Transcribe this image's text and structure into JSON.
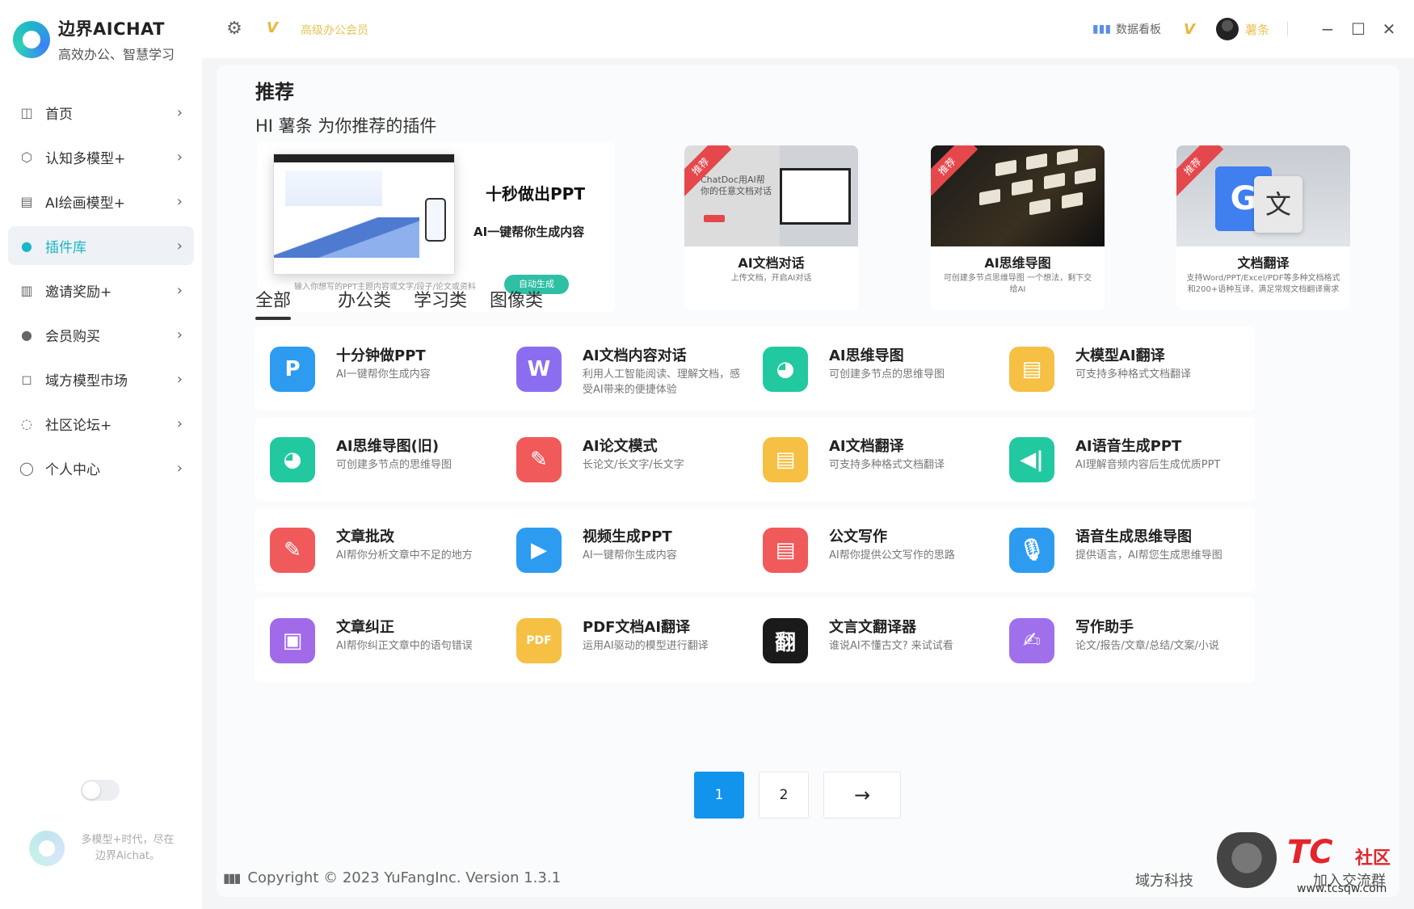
{
  "brand": {
    "title": "边界AICHAT",
    "subtitle": "高效办公、智慧学习"
  },
  "sidebar": {
    "items": [
      {
        "label": "首页",
        "icon": "home-icon",
        "glyph": "◫"
      },
      {
        "label": "认知多模型+",
        "icon": "cube-icon",
        "glyph": "⬡"
      },
      {
        "label": "AI绘画模型+",
        "icon": "image-icon",
        "glyph": "▤"
      },
      {
        "label": "插件库",
        "icon": "lightbulb-icon",
        "glyph": "●"
      },
      {
        "label": "邀请奖励+",
        "icon": "gift-icon",
        "glyph": "▥"
      },
      {
        "label": "会员购买",
        "icon": "user-icon",
        "glyph": "●"
      },
      {
        "label": "域方模型市场",
        "icon": "shop-icon",
        "glyph": "◻"
      },
      {
        "label": "社区论坛+",
        "icon": "chat-icon",
        "glyph": "◌"
      },
      {
        "label": "个人中心",
        "icon": "person-icon",
        "glyph": "◯"
      }
    ],
    "active_index": 3,
    "footer_text": "多模型+时代，尽在边界Aichat。"
  },
  "topbar": {
    "vip_label": "高级办公会员",
    "dashboard_label": "数据看板",
    "user_name": "薯条"
  },
  "main": {
    "section_title": "推荐",
    "greeting": "HI 薯条 为你推荐的插件",
    "banner": {
      "title": "十秒做出PPT",
      "subtitle": "AI一键帮你生成内容",
      "description": "输入你想写的PPT主题内容或文字/段子/论文或资料",
      "button": "自动生成"
    },
    "recommended": [
      {
        "ribbon": "推荐",
        "title": "AI文档对话",
        "desc": "上传文档，开启AI对话",
        "image_text": "ChatDoc用AI帮你的任意文档对话"
      },
      {
        "ribbon": "推荐",
        "title": "AI思维导图",
        "desc": "可创建多节点思维导图 一个想法，剩下交给AI"
      },
      {
        "ribbon": "推荐",
        "title": "文档翻译",
        "desc": "支持Word/PPT/Excel/PDF等多种文档格式和200+语种互译，满足常规文档翻译需求"
      }
    ],
    "tabs": [
      "全部",
      "办公类",
      "学习类",
      "图像类"
    ],
    "active_tab": 0,
    "plugins": [
      {
        "title": "十分钟做PPT",
        "desc": "AI一键帮你生成内容",
        "icon": "ppt-icon",
        "color": "#2d9cf0",
        "glyph": "P"
      },
      {
        "title": "AI文档内容对话",
        "desc": "利用人工智能阅读、理解文档，感受AI带来的便捷体验",
        "icon": "word-doc-icon",
        "color": "#8b6ef0",
        "glyph": "W"
      },
      {
        "title": "AI思维导图",
        "desc": "可创建多节点的思维导图",
        "icon": "brain-icon",
        "color": "#22c9a0",
        "glyph": "◕"
      },
      {
        "title": "大模型AI翻译",
        "desc": "可支持多种格式文档翻译",
        "icon": "translate-doc-icon",
        "color": "#f5c043",
        "glyph": "▤"
      },
      {
        "title": "AI思维导图(旧)",
        "desc": "可创建多节点的思维导图",
        "icon": "brain-icon",
        "color": "#22c9a0",
        "glyph": "◕"
      },
      {
        "title": "AI论文模式",
        "desc": "长论文/长文字/长文字",
        "icon": "pen-brush-icon",
        "color": "#f05a5a",
        "glyph": "✎"
      },
      {
        "title": "AI文档翻译",
        "desc": "可支持多种格式文档翻译",
        "icon": "translate-doc-icon",
        "color": "#f5c043",
        "glyph": "▤"
      },
      {
        "title": "AI语音生成PPT",
        "desc": "AI理解音频内容后生成优质PPT",
        "icon": "audio-icon",
        "color": "#22c9a0",
        "glyph": "◀|"
      },
      {
        "title": "文章批改",
        "desc": "AI帮你分析文章中不足的地方",
        "icon": "edit-icon",
        "color": "#f05a5a",
        "glyph": "✎"
      },
      {
        "title": "视频生成PPT",
        "desc": "AI一键帮你生成内容",
        "icon": "video-icon",
        "color": "#2d9cf0",
        "glyph": "▶"
      },
      {
        "title": "公文写作",
        "desc": "AI帮你提供公文写作的思路",
        "icon": "document-icon",
        "color": "#f05a5a",
        "glyph": "▤"
      },
      {
        "title": "语音生成思维导图",
        "desc": "提供语言，AI帮您生成思维导图",
        "icon": "microphone-icon",
        "color": "#2d9cf0",
        "glyph": "🎙"
      },
      {
        "title": "文章纠正",
        "desc": "AI帮你纠正文章中的语句错误",
        "icon": "save-icon",
        "color": "#a06ae8",
        "glyph": "▣"
      },
      {
        "title": "PDF文档AI翻译",
        "desc": "运用AI驱动的模型进行翻译",
        "icon": "pdf-icon",
        "color": "#f5c043",
        "glyph": "PDF"
      },
      {
        "title": "文言文翻译器",
        "desc": "谁说AI不懂古文? 来试试看",
        "icon": "classical-text-icon",
        "color": "#1a1a1a",
        "glyph": "翻"
      },
      {
        "title": "写作助手",
        "desc": "论文/报告/文章/总结/文案/小说",
        "icon": "writing-icon",
        "color": "#a070ec",
        "glyph": "✍"
      }
    ]
  },
  "pagination": {
    "pages": [
      "1",
      "2"
    ],
    "active": 0,
    "next": "→"
  },
  "footer": {
    "copyright": "Copyright © 2023 YuFangInc. Version 1.3.1",
    "company": "域方科技",
    "join": "加入交流群"
  },
  "watermark": {
    "tc": "TC",
    "she": "社区",
    "url": "www.tcsqw.com"
  }
}
